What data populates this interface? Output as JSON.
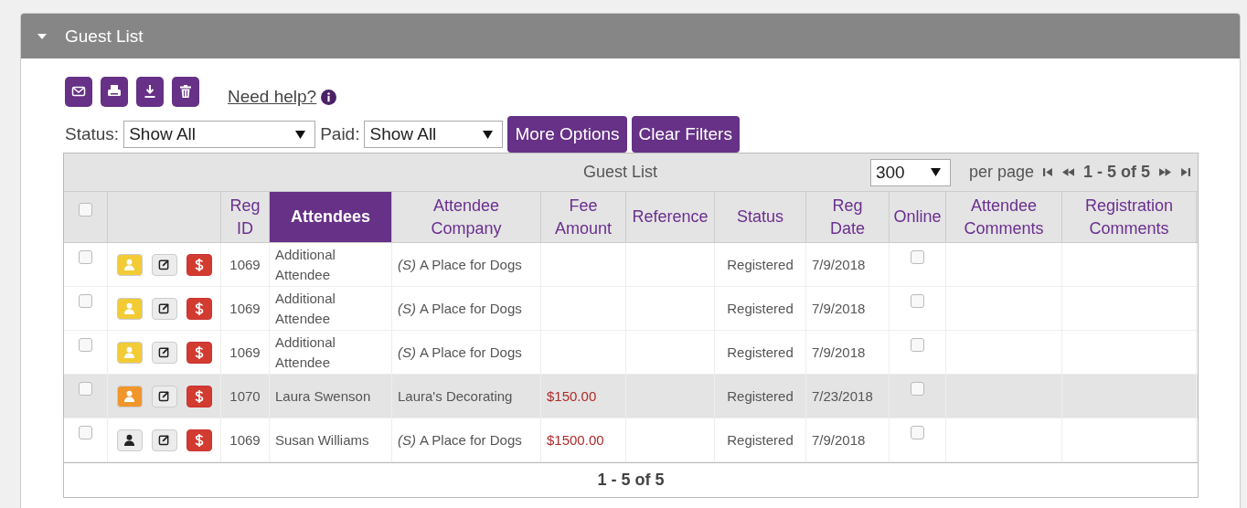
{
  "panel": {
    "title": "Guest List",
    "expanded": true
  },
  "help_link": "Need help?",
  "filters": [
    {
      "label": "Status:",
      "value": "Show All"
    },
    {
      "label": "Paid:",
      "value": "Show All"
    }
  ],
  "buttons": [
    "More Options",
    "Clear Filters"
  ],
  "table": {
    "caption": "Guest List",
    "page_size": "300",
    "per_page_label": "per page",
    "range": "1 - 5 of 5",
    "select_all_checked": false,
    "columns": [
      {
        "label": "Reg ID",
        "selected": false
      },
      {
        "label": "Attendees",
        "selected": true
      },
      {
        "label": "Attendee Company",
        "selected": false
      },
      {
        "label": "Fee Amount",
        "selected": false
      },
      {
        "label": "Reference",
        "selected": false
      },
      {
        "label": "Status",
        "selected": false
      },
      {
        "label": "Reg Date",
        "selected": false
      },
      {
        "label": "Online",
        "selected": false
      },
      {
        "label": "Attendee Comments",
        "selected": false
      },
      {
        "label": "Registration Comments",
        "selected": false
      }
    ],
    "rows": [
      {
        "checked": false,
        "highlighted": false,
        "color": "#f2cb35",
        "reg_id": "1069",
        "attendee": "Additional Attendee",
        "company_prefix": "(S)",
        "company": "A Place for Dogs",
        "fee": "",
        "status": "Registered",
        "reg_date": "7/9/2018",
        "online": false
      },
      {
        "checked": false,
        "highlighted": false,
        "color": "#f2cb35",
        "reg_id": "1069",
        "attendee": "Additional Attendee",
        "company_prefix": "(S)",
        "company": "A Place for Dogs",
        "fee": "",
        "status": "Registered",
        "reg_date": "7/9/2018",
        "online": false
      },
      {
        "checked": false,
        "highlighted": false,
        "color": "#f2cb35",
        "reg_id": "1069",
        "attendee": "Additional Attendee",
        "company_prefix": "(S)",
        "company": "A Place for Dogs",
        "fee": "",
        "status": "Registered",
        "reg_date": "7/9/2018",
        "online": false
      },
      {
        "checked": false,
        "highlighted": true,
        "color": "#f0962a",
        "reg_id": "1070",
        "attendee": "Laura Swenson",
        "company": "Laura's Decorating",
        "fee": "$150.00",
        "status": "Registered",
        "reg_date": "7/23/2018",
        "online": false
      },
      {
        "checked": false,
        "highlighted": false,
        "color": "#ececec",
        "reg_id": "1069",
        "attendee": "Susan Williams",
        "company_prefix": "(S)",
        "company": "A Place for Dogs",
        "fee": "$1500.00",
        "status": "Registered",
        "reg_date": "7/9/2018",
        "online": false
      }
    ],
    "footer_range": "1 - 5 of 5"
  }
}
